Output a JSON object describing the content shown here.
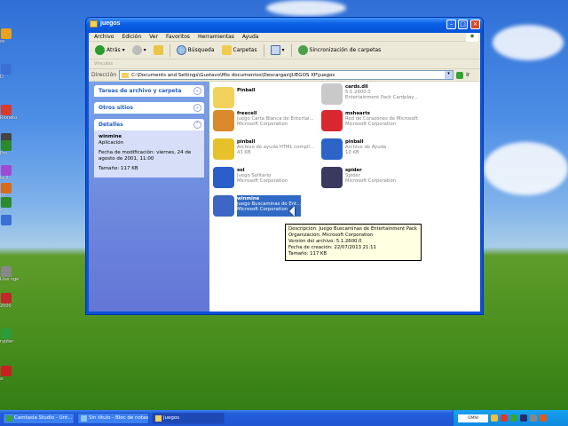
{
  "window": {
    "title": "juegos",
    "menu": [
      "Archivo",
      "Edición",
      "Ver",
      "Favoritos",
      "Herramientas",
      "Ayuda"
    ],
    "toolbar": {
      "back": "Atrás",
      "search": "Búsqueda",
      "folders": "Carpetas",
      "sync": "Sincronización de carpetas"
    },
    "links_label": "Vínculos",
    "address_label": "Dirección",
    "address_value": "C:\\Documents and Settings\\Gustavo\\Mis documentos\\Descargas\\JUEGOS XP\\juegos",
    "go_label": "Ir"
  },
  "tasks": {
    "file_tasks": "Tareas de archivo y carpeta",
    "other_sites": "Otros sitios",
    "details_title": "Detalles",
    "details": {
      "name": "winmine",
      "type": "Aplicación",
      "modified": "Fecha de modificación: viernes, 24 de agosto de 2001, 11:00",
      "size": "Tamaño: 117 KB"
    }
  },
  "files": [
    {
      "name": "Pinball",
      "line1": "",
      "line2": "",
      "color": "#f2d15c"
    },
    {
      "name": "cards.dll",
      "line1": "5.1.2600.0",
      "line2": "Entertainment Pack Cardplay...",
      "color": "#c9c9c9"
    },
    {
      "name": "freecell",
      "line1": "Juego Carta Blanca de Entertai...",
      "line2": "Microsoft Corporation",
      "color": "#d9892a"
    },
    {
      "name": "mshearts",
      "line1": "Red de Corazones de Microsoft",
      "line2": "Microsoft Corporation",
      "color": "#d8272f"
    },
    {
      "name": "pinball",
      "line1": "Archivo de ayuda HTML compil...",
      "line2": "43 KB",
      "color": "#e6c12a"
    },
    {
      "name": "pinball",
      "line1": "Archivo de Ayuda",
      "line2": "10 KB",
      "color": "#2c64c8"
    },
    {
      "name": "sol",
      "line1": "Juego Solitario",
      "line2": "Microsoft Corporation",
      "color": "#2b5ec9"
    },
    {
      "name": "spider",
      "line1": "Spider",
      "line2": "Microsoft Corporation",
      "color": "#3a3a5e"
    },
    {
      "name": "winmine",
      "line1": "Juego Buscaminas de Ent...",
      "line2": "Microsoft Corporation",
      "color": "#3e66c4"
    }
  ],
  "tooltip": [
    "Descripción: Juego Buscaminas de Entertainment Pack",
    "Organización: Microsoft Corporation",
    "Versión del archivo: 5.1.2600.0",
    "Fecha de creación: 22/07/2013 21:11",
    "Tamaño: 117 KB"
  ],
  "desktop_icons": [
    {
      "label": "os",
      "color": "#e8a21b"
    },
    {
      "label": "D",
      "color": "#3b6fd6"
    },
    {
      "label": "Rioneto",
      "color": "#d93a2a"
    },
    {
      "label": "",
      "color": "#444"
    },
    {
      "label": "Pro",
      "color": "#2c8a2c"
    },
    {
      "label": "te 2",
      "color": "#a04ad0"
    },
    {
      "label": "RY",
      "color": "#d96a1a"
    },
    {
      "label": "e",
      "color": "#2c8a2c"
    },
    {
      "label": "",
      "color": "#3b6fd6"
    },
    {
      "label": "Live nge",
      "color": "#888"
    },
    {
      "label": "2000",
      "color": "#c0282a"
    },
    {
      "label": "rypter",
      "color": "#2a9c3a"
    },
    {
      "label": "a",
      "color": "#cc1f1f"
    }
  ],
  "taskbar": {
    "items": [
      "Camtasia Studio - Unt...",
      "Sin título - Bloc de notas",
      "juegos"
    ],
    "tray_logo": "OMNI"
  }
}
